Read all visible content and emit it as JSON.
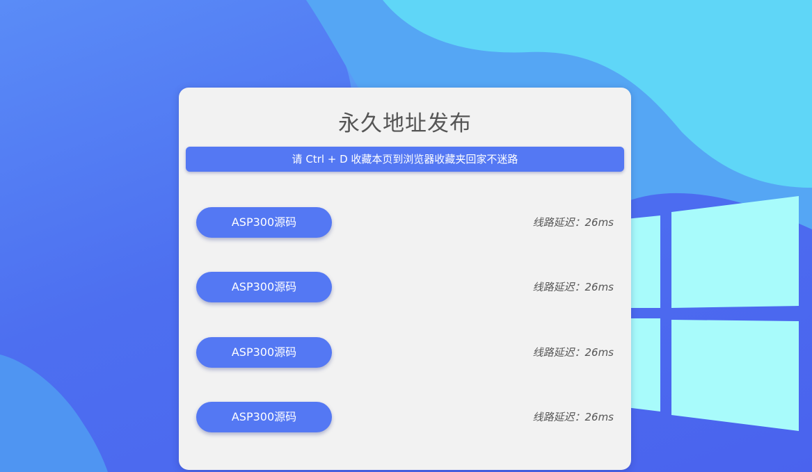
{
  "page": {
    "title": "永久地址发布",
    "notice": "请 Ctrl + D 收藏本页到浏览器收藏夹回家不迷路"
  },
  "links": [
    {
      "label": "ASP300源码",
      "latency_label": "线路延迟：",
      "latency_value": "26ms"
    },
    {
      "label": "ASP300源码",
      "latency_label": "线路延迟：",
      "latency_value": "26ms"
    },
    {
      "label": "ASP300源码",
      "latency_label": "线路延迟：",
      "latency_value": "26ms"
    },
    {
      "label": "ASP300源码",
      "latency_label": "线路延迟：",
      "latency_value": "26ms"
    }
  ],
  "theme": {
    "background": "#4d6ff0",
    "accent": "#5478f3",
    "card": "#f2f2f2",
    "logo_color": "#a8fbfb"
  },
  "icons": {
    "background_logo": "windows-logo-icon"
  }
}
